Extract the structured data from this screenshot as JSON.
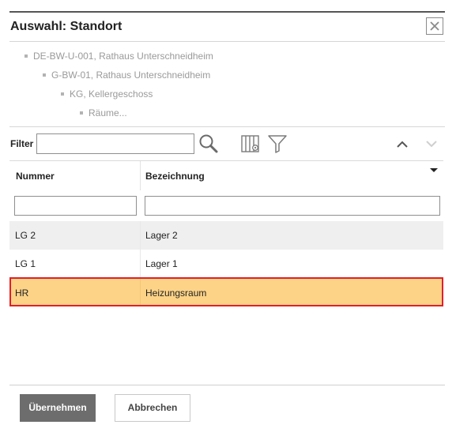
{
  "dialog": {
    "title": "Auswahl: Standort"
  },
  "breadcrumb": [
    {
      "label": "DE-BW-U-001, Rathaus Unterschneidheim"
    },
    {
      "label": "G-BW-01, Rathaus Unterschneidheim"
    },
    {
      "label": "KG, Kellergeschoss"
    },
    {
      "label": "Räume..."
    }
  ],
  "toolbar": {
    "filter_label": "Filter",
    "filter_value": "",
    "icons": [
      "search-icon",
      "column-chooser-icon",
      "funnel-icon",
      "chevron-up-icon",
      "chevron-down-icon"
    ]
  },
  "table": {
    "columns": [
      "Nummer",
      "Bezeichnung"
    ],
    "filters": [
      "",
      ""
    ],
    "rows": [
      {
        "nummer": "LG 2",
        "bezeichnung": "Lager 2",
        "selected": false
      },
      {
        "nummer": "LG 1",
        "bezeichnung": "Lager 1",
        "selected": false
      },
      {
        "nummer": "HR",
        "bezeichnung": "Heizungsraum",
        "selected": true
      }
    ]
  },
  "actions": {
    "apply_label": "Übernehmen",
    "cancel_label": "Abbrechen"
  },
  "colors": {
    "selected_row": "#fdd387",
    "selected_border": "#e0202a",
    "primary_button": "#6d6d6d"
  }
}
